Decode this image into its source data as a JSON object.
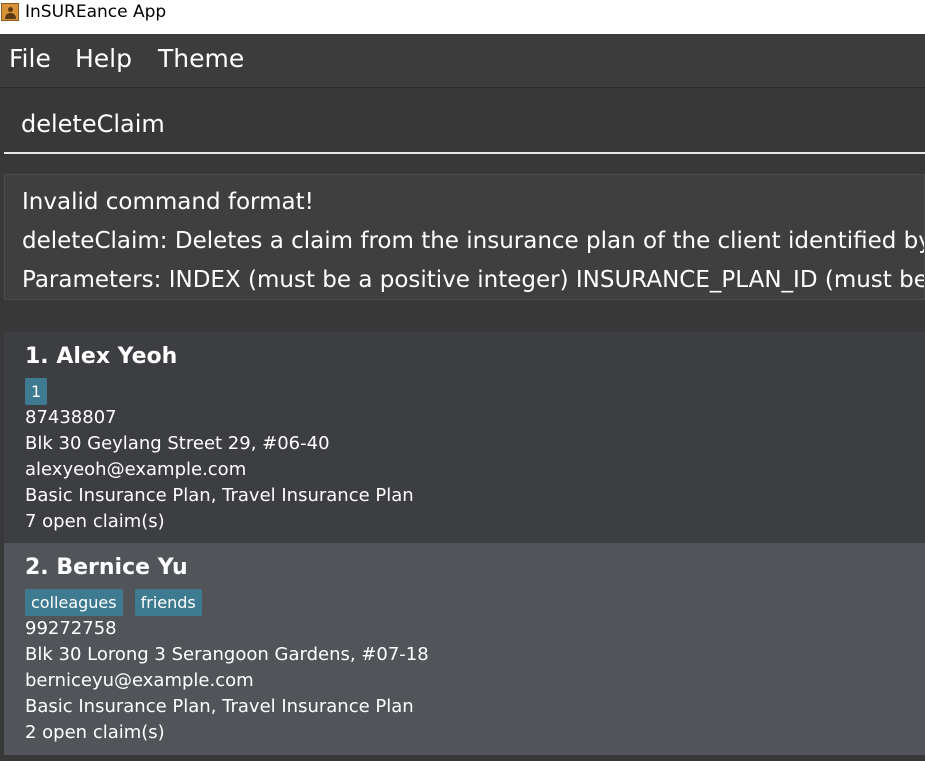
{
  "window": {
    "title": "InSUREance App",
    "icon": "person-icon"
  },
  "menu": {
    "file": "File",
    "help": "Help",
    "theme": "Theme"
  },
  "command": {
    "value": "deleteClaim"
  },
  "result": {
    "lines": [
      "Invalid command format!",
      "deleteClaim: Deletes a claim from the insurance plan of the client identified by their",
      "Parameters: INDEX (must be a positive integer)  INSURANCE_PLAN_ID (must be a v"
    ]
  },
  "clients": [
    {
      "name": "1. Alex Yeoh",
      "tags": [
        "1"
      ],
      "phone": "87438807",
      "address": "Blk 30 Geylang Street 29, #06-40",
      "email": "alexyeoh@example.com",
      "plans": "Basic Insurance Plan, Travel Insurance Plan",
      "claims": "7 open claim(s)"
    },
    {
      "name": "2. Bernice Yu",
      "tags": [
        "colleagues",
        "friends"
      ],
      "phone": "99272758",
      "address": "Blk 30 Lorong 3 Serangoon Gardens, #07-18",
      "email": "berniceyu@example.com",
      "plans": "Basic Insurance Plan, Travel Insurance Plan",
      "claims": "2 open claim(s)"
    }
  ],
  "colors": {
    "tag": "#3e7b91",
    "selected_card": "#51555a",
    "card": "#3d3e41"
  }
}
